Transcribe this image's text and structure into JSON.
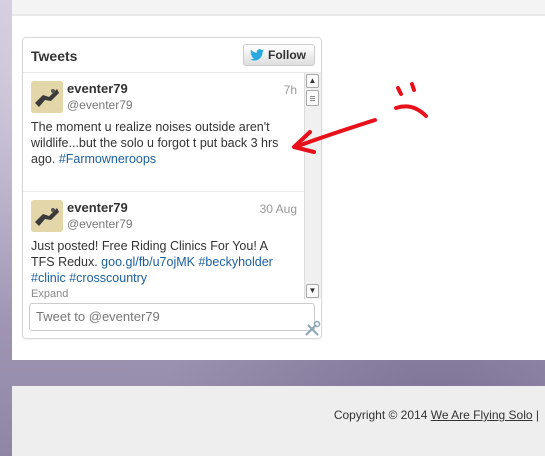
{
  "widget": {
    "title": "Tweets",
    "follow_label": "Follow",
    "tweets": [
      {
        "author": "eventer79",
        "handle": "@eventer79",
        "time": "7h",
        "text": "The moment u realize noises outside aren't wildlife...but the solo u forgot t put back 3 hrs ago. ",
        "hashtag": "#Farmowneroops"
      },
      {
        "author": "eventer79",
        "handle": "@eventer79",
        "time": "30 Aug",
        "text": "Just posted! Free Riding Clinics For You! A TFS Redux. ",
        "link": "goo.gl/fb/u7ojMK",
        "hashtag1": "#beckyholder",
        "hashtag2": "#clinic",
        "hashtag3": "#crosscountry",
        "expand": "Expand"
      }
    ],
    "tweet_box_placeholder": "Tweet to @eventer79"
  },
  "footer": {
    "copyright_prefix": "Copyright © 2014 ",
    "site_link": "We Are Flying Solo",
    "separator": " |"
  },
  "colors": {
    "link": "#1c5f9e",
    "annotation": "#e8101a",
    "twitter_bird": "#2aa9e0"
  }
}
